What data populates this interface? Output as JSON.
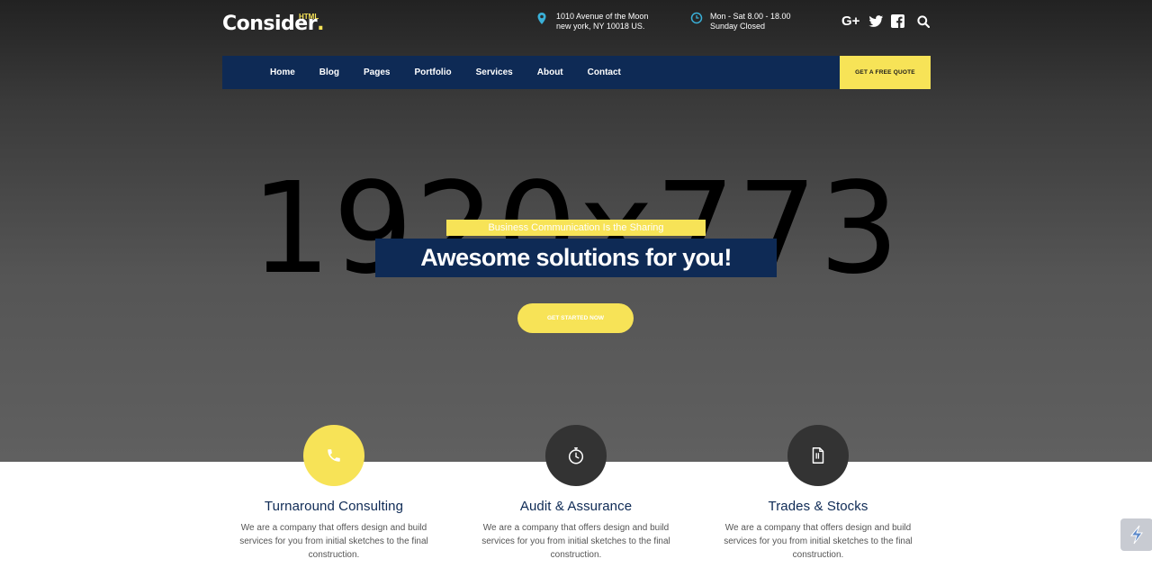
{
  "header": {
    "logo": {
      "text": "Consider",
      "dot": ".",
      "badge": "HTML"
    },
    "address": {
      "line1": "1010 Avenue of the Moon",
      "line2": "new york, NY 10018 US."
    },
    "hours": {
      "line1": "Mon - Sat 8.00 - 18.00",
      "line2": "Sunday Closed"
    },
    "socials": [
      {
        "icon": "google-plus-icon",
        "glyph": "G+"
      },
      {
        "icon": "twitter-icon"
      },
      {
        "icon": "facebook-icon"
      }
    ]
  },
  "nav": {
    "items": [
      "Home",
      "Blog",
      "Pages",
      "Portfolio",
      "Services",
      "About",
      "Contact"
    ],
    "quote_button": "GET A FREE QUOTE"
  },
  "hero": {
    "placeholder": "1920x773",
    "subtag": "Business Communication Is the Sharing",
    "headline": "Awesome solutions for you!",
    "cta": "GET STARTED NOW"
  },
  "services": [
    {
      "icon": "phone-icon",
      "title": "Turnaround Consulting",
      "desc": "We are a company that offers design and build services for you from initial sketches to the final construction."
    },
    {
      "icon": "stopwatch-icon",
      "title": "Audit & Assurance",
      "desc": "We are a company that offers design and build services for you from initial sketches to the final construction."
    },
    {
      "icon": "document-icon",
      "title": "Trades & Stocks",
      "desc": "We are a company that offers design and build services for you from initial sketches to the final construction."
    }
  ],
  "colors": {
    "accent": "#f7e357",
    "navy": "#0e2a55",
    "dark": "#333333"
  }
}
